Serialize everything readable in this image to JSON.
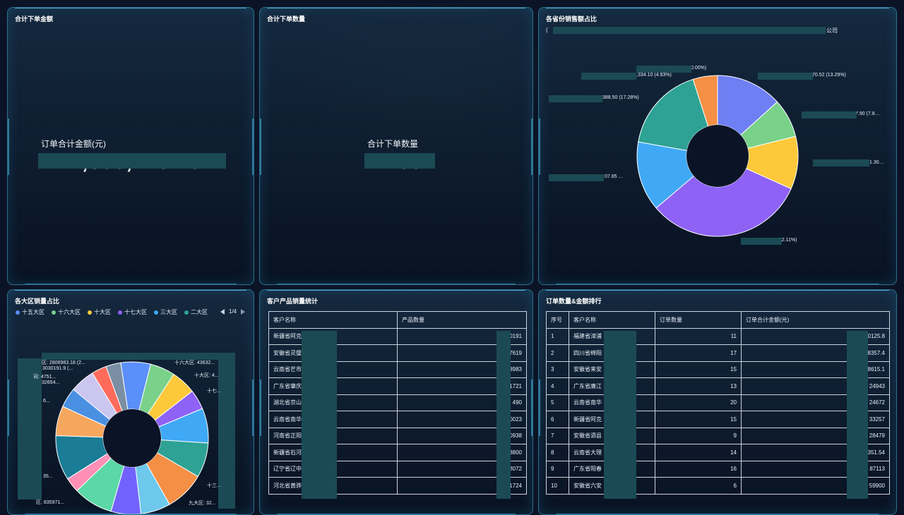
{
  "panels": {
    "total_amount": {
      "title": "合计下单金额",
      "label": "订单合计金额(元)",
      "value": "147,395,440.40"
    },
    "total_qty": {
      "title": "合计下单数量",
      "label": "合计下单数量",
      "value": "1265"
    },
    "province_share": {
      "title": "各省份销售额占比",
      "header_suffix": "公司",
      "labels": [
        "70.52 (13.29%)",
        "7.90 (7.8…",
        "1.30…",
        "3.36 (32.11%)",
        "07.85 …",
        "388.50 (17.28%)",
        ",334.10 (4.93%)",
        "0.00%)"
      ],
      "colors": [
        "#6e7ff3",
        "#79d18a",
        "#fdc93a",
        "#8e62f5",
        "#3fa9f5",
        "#2ea294",
        "#f48f45"
      ]
    },
    "region_share": {
      "title": "各大区销量占比",
      "legend": [
        {
          "name": "十五大区",
          "color": "#5b8ff9"
        },
        {
          "name": "十六大区",
          "color": "#79d18a"
        },
        {
          "name": "十大区",
          "color": "#fdc93a"
        },
        {
          "name": "十七大区",
          "color": "#8e62f5"
        },
        {
          "name": "三大区",
          "color": "#3fa9f5"
        },
        {
          "name": "二大区",
          "color": "#2ea294"
        }
      ],
      "page": "1/4",
      "labels": [
        "区: 2806983.18 (2...",
        "3030191.9 (...",
        "司: 4751...",
        "32654...",
        "6...",
        "35...",
        "区: 835971...",
        "十六大区: 43632...",
        "十大区: 4...",
        "十七...",
        "十三...",
        "九大区: 32..."
      ],
      "colors": [
        "#5b8ff9",
        "#79d18a",
        "#fdc93a",
        "#8e62f5",
        "#3fa9f5",
        "#2ea294",
        "#f48f45",
        "#6dc8ec",
        "#7262fd",
        "#5ad8a6",
        "#ff8fb5",
        "#1a7c96",
        "#f6a75e",
        "#4a90e2",
        "#cbc6ef",
        "#ff6b5b",
        "#7a8fa3"
      ]
    },
    "customer_products": {
      "title": "客户产品销量统计",
      "headers": [
        "客户名称",
        "产品数量"
      ],
      "rows": [
        [
          "新疆省阿克",
          "0191"
        ],
        [
          "安徽省灵璧",
          "7619"
        ],
        [
          "云南省芒市",
          "8983"
        ],
        [
          "广东省肇庆",
          "1721"
        ],
        [
          "湖北省京山",
          "490"
        ],
        [
          "云南省南华",
          "0023"
        ],
        [
          "河南省正阳",
          "0938"
        ],
        [
          "新疆省石河",
          "8800"
        ],
        [
          "辽宁省辽中",
          "8072"
        ],
        [
          "河北省黄骅",
          "1724"
        ]
      ]
    },
    "order_rank": {
      "title": "订单数量&金额排行",
      "headers": [
        "序号",
        "客户名称",
        "订单数量",
        "订单合计金额(元)"
      ],
      "rows": [
        [
          "1",
          "福建省漳浦",
          "11",
          "0125.8"
        ],
        [
          "2",
          "四川省绵阳",
          "17",
          "8357.4"
        ],
        [
          "3",
          "安徽省来安",
          "15",
          "8615.1"
        ],
        [
          "4",
          "广东省廉江",
          "13",
          "24943"
        ],
        [
          "5",
          "云南省南华",
          "20",
          "24672"
        ],
        [
          "6",
          "新疆省阿克",
          "15",
          "33257"
        ],
        [
          "7",
          "安徽省泗县",
          "9",
          "28479"
        ],
        [
          "8",
          "云南省大理",
          "14",
          "351.54"
        ],
        [
          "9",
          "广东省阳春",
          "16",
          "87113"
        ],
        [
          "10",
          "安徽省六安",
          "6",
          "59900"
        ]
      ]
    }
  },
  "chart_data": [
    {
      "type": "pie",
      "title": "各省份销售额占比",
      "values": [
        13.29,
        7.8,
        10.6,
        32.11,
        13.99,
        17.28,
        4.93
      ]
    },
    {
      "type": "pie",
      "title": "各大区销量占比",
      "values": [
        6,
        5,
        5,
        4,
        7,
        7,
        8,
        6,
        6,
        8,
        3,
        9,
        6,
        4,
        5,
        3,
        3
      ]
    }
  ]
}
